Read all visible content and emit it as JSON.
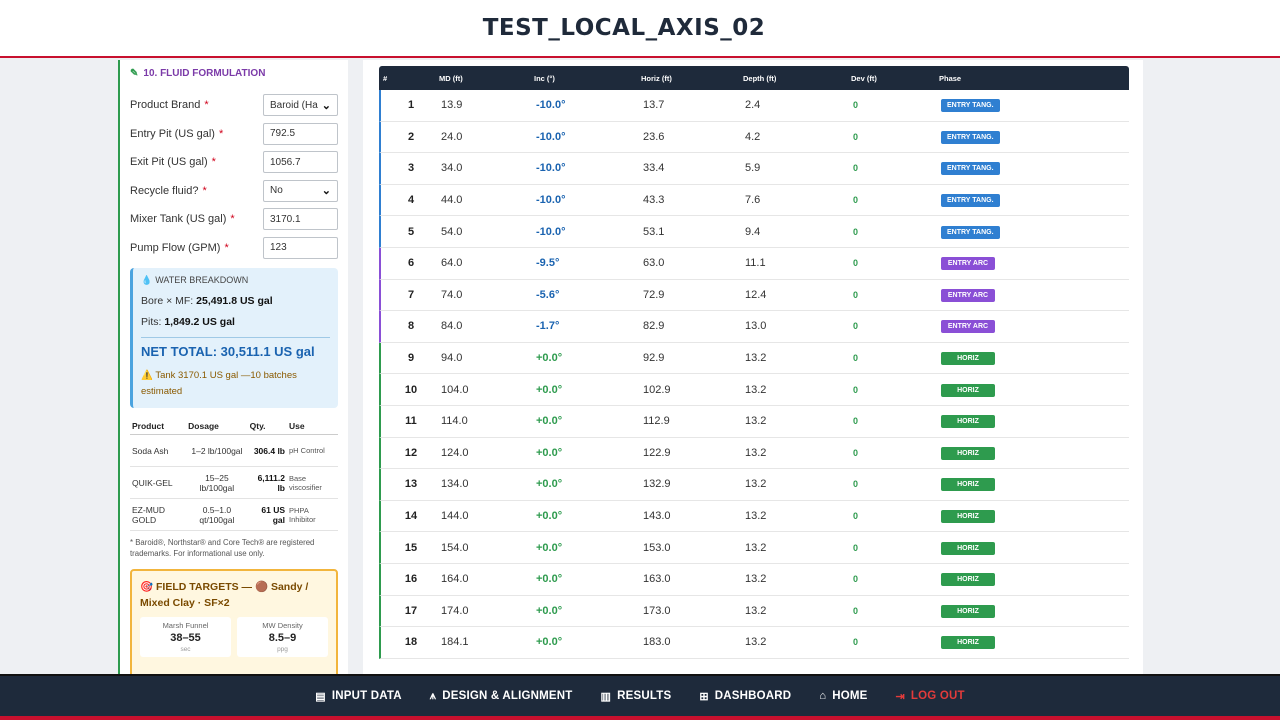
{
  "page_title": "TEST_LOCAL_AXIS_02",
  "fluid": {
    "section_title": "10. FLUID FORMULATION",
    "fields": [
      {
        "label": "Product Brand",
        "type": "select",
        "value": "Baroid (Ha"
      },
      {
        "label": "Entry Pit (US gal)",
        "type": "input",
        "value": "792.5"
      },
      {
        "label": "Exit Pit (US gal)",
        "type": "input",
        "value": "1056.7"
      },
      {
        "label": "Recycle fluid?",
        "type": "select",
        "value": "No"
      },
      {
        "label": "Mixer Tank (US gal)",
        "type": "input",
        "value": "3170.1"
      },
      {
        "label": "Pump Flow (GPM)",
        "type": "input",
        "value": "123"
      }
    ]
  },
  "water": {
    "title": "WATER BREAKDOWN",
    "bore_label": "Bore × MF:",
    "bore_value": "25,491.8 US gal",
    "pits_label": "Pits:",
    "pits_value": "1,849.2 US gal",
    "net_total": "NET TOTAL: 30,511.1 US gal",
    "note": "Tank 3170.1 US gal —10 batches estimated"
  },
  "products": {
    "headers": [
      "Product",
      "Dosage",
      "Qty.",
      "Use"
    ],
    "rows": [
      {
        "product": "Soda Ash",
        "dosage": "1–2 lb/100gal",
        "qty": "306.4 lb",
        "use": "pH Control"
      },
      {
        "product": "QUIK-GEL",
        "dosage": "15–25 lb/100gal",
        "qty": "6,111.2 lb",
        "use": "Base viscosifier"
      },
      {
        "product": "EZ-MUD GOLD",
        "dosage": "0.5–1.0 qt/100gal",
        "qty": "61 US gal",
        "use": "PHPA Inhibitor"
      }
    ]
  },
  "trademark": "* Baroid®, Northstar® and Core Tech® are registered trademarks. For informational use only.",
  "targets": {
    "title": "FIELD TARGETS — 🟤 Sandy / Mixed Clay · SF×2",
    "cards": [
      {
        "label": "Marsh Funnel",
        "value": "38–55",
        "unit": "sec"
      },
      {
        "label": "MW Density",
        "value": "8.5–9",
        "unit": "ppg"
      }
    ]
  },
  "table": {
    "headers": [
      "#",
      "MD (ft)",
      "Inc (°)",
      "Horiz (ft)",
      "Depth (ft)",
      "Dev (ft)",
      "Phase"
    ],
    "rows": [
      {
        "n": "1",
        "md": "13.9",
        "inc": "-10.0°",
        "horiz": "13.7",
        "depth": "2.4",
        "dev": "0",
        "phase": "ENTRY TANG."
      },
      {
        "n": "2",
        "md": "24.0",
        "inc": "-10.0°",
        "horiz": "23.6",
        "depth": "4.2",
        "dev": "0",
        "phase": "ENTRY TANG."
      },
      {
        "n": "3",
        "md": "34.0",
        "inc": "-10.0°",
        "horiz": "33.4",
        "depth": "5.9",
        "dev": "0",
        "phase": "ENTRY TANG."
      },
      {
        "n": "4",
        "md": "44.0",
        "inc": "-10.0°",
        "horiz": "43.3",
        "depth": "7.6",
        "dev": "0",
        "phase": "ENTRY TANG."
      },
      {
        "n": "5",
        "md": "54.0",
        "inc": "-10.0°",
        "horiz": "53.1",
        "depth": "9.4",
        "dev": "0",
        "phase": "ENTRY TANG."
      },
      {
        "n": "6",
        "md": "64.0",
        "inc": "-9.5°",
        "horiz": "63.0",
        "depth": "11.1",
        "dev": "0",
        "phase": "ENTRY ARC"
      },
      {
        "n": "7",
        "md": "74.0",
        "inc": "-5.6°",
        "horiz": "72.9",
        "depth": "12.4",
        "dev": "0",
        "phase": "ENTRY ARC"
      },
      {
        "n": "8",
        "md": "84.0",
        "inc": "-1.7°",
        "horiz": "82.9",
        "depth": "13.0",
        "dev": "0",
        "phase": "ENTRY ARC"
      },
      {
        "n": "9",
        "md": "94.0",
        "inc": "+0.0°",
        "horiz": "92.9",
        "depth": "13.2",
        "dev": "0",
        "phase": "HORIZ"
      },
      {
        "n": "10",
        "md": "104.0",
        "inc": "+0.0°",
        "horiz": "102.9",
        "depth": "13.2",
        "dev": "0",
        "phase": "HORIZ"
      },
      {
        "n": "11",
        "md": "114.0",
        "inc": "+0.0°",
        "horiz": "112.9",
        "depth": "13.2",
        "dev": "0",
        "phase": "HORIZ"
      },
      {
        "n": "12",
        "md": "124.0",
        "inc": "+0.0°",
        "horiz": "122.9",
        "depth": "13.2",
        "dev": "0",
        "phase": "HORIZ"
      },
      {
        "n": "13",
        "md": "134.0",
        "inc": "+0.0°",
        "horiz": "132.9",
        "depth": "13.2",
        "dev": "0",
        "phase": "HORIZ"
      },
      {
        "n": "14",
        "md": "144.0",
        "inc": "+0.0°",
        "horiz": "143.0",
        "depth": "13.2",
        "dev": "0",
        "phase": "HORIZ"
      },
      {
        "n": "15",
        "md": "154.0",
        "inc": "+0.0°",
        "horiz": "153.0",
        "depth": "13.2",
        "dev": "0",
        "phase": "HORIZ"
      },
      {
        "n": "16",
        "md": "164.0",
        "inc": "+0.0°",
        "horiz": "163.0",
        "depth": "13.2",
        "dev": "0",
        "phase": "HORIZ"
      },
      {
        "n": "17",
        "md": "174.0",
        "inc": "+0.0°",
        "horiz": "173.0",
        "depth": "13.2",
        "dev": "0",
        "phase": "HORIZ"
      },
      {
        "n": "18",
        "md": "184.1",
        "inc": "+0.0°",
        "horiz": "183.0",
        "depth": "13.2",
        "dev": "0",
        "phase": "HORIZ"
      }
    ]
  },
  "phase_colors": {
    "ENTRY TANG.": "#2f7fd1",
    "ENTRY ARC": "#8a4fd6",
    "HORIZ": "#2e9b4e"
  },
  "inc_colors": {
    "negative": "#1a63b0",
    "zero": "#2e9b4e"
  },
  "nav": [
    {
      "label": "INPUT DATA",
      "icon": "clipboard-icon",
      "glyph": "▤"
    },
    {
      "label": "DESIGN & ALIGNMENT",
      "icon": "compass-icon",
      "glyph": "⩚"
    },
    {
      "label": "RESULTS",
      "icon": "chart-icon",
      "glyph": "▥"
    },
    {
      "label": "DASHBOARD",
      "icon": "grid-icon",
      "glyph": "⊞"
    },
    {
      "label": "HOME",
      "icon": "home-icon",
      "glyph": "⌂"
    },
    {
      "label": "LOG OUT",
      "icon": "logout-icon",
      "glyph": "⇥"
    }
  ]
}
